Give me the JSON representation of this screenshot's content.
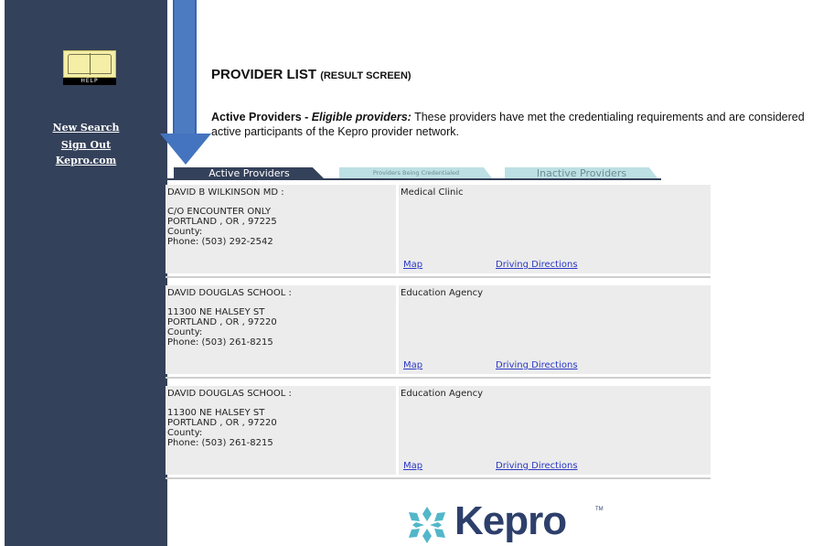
{
  "sidebar": {
    "help_label": "HELP",
    "links": [
      "New Search",
      "Sign Out",
      "Kepro.com"
    ]
  },
  "header": {
    "title": "PROVIDER LIST",
    "title_sub": "(RESULT SCREEN)",
    "desc_bold": "Active Providers - ",
    "desc_italic": "Eligible providers:",
    "desc_rest": " These providers have met the credentialing requirements and are considered active participants of the Kepro provider network."
  },
  "tabs": [
    "Active Providers",
    "Providers Being Credentialed",
    "Inactive Providers"
  ],
  "providers": [
    {
      "name": "DAVID B WILKINSON MD  :",
      "address1": "C/O ENCOUNTER ONLY",
      "address2": "PORTLAND , OR , 97225",
      "county": "County:",
      "phone": "Phone: (503) 292-2542",
      "type": "Medical Clinic",
      "map": "Map",
      "directions": "Driving Directions"
    },
    {
      "name": "DAVID DOUGLAS SCHOOL  :",
      "address1": "11300 NE HALSEY ST",
      "address2": "PORTLAND , OR , 97220",
      "county": "County:",
      "phone": "Phone: (503) 261-8215",
      "type": "Education Agency",
      "map": "Map",
      "directions": "Driving Directions"
    },
    {
      "name": "DAVID DOUGLAS SCHOOL  :",
      "address1": "11300 NE HALSEY ST",
      "address2": "PORTLAND , OR , 97220",
      "county": "County:",
      "phone": "Phone: (503) 261-8215",
      "type": "Education Agency",
      "map": "Map",
      "directions": "Driving Directions"
    }
  ],
  "logo": {
    "text": "Kepro",
    "tm": "TM"
  },
  "colors": {
    "sidebar": "#34415a",
    "tab_inactive": "#bde0e4",
    "link": "#2b38c4",
    "arrow": "#4474bf",
    "logo_mark": "#52b7c9"
  },
  "icons": {
    "help": "book-icon",
    "arrow": "down-arrow-icon",
    "logo": "kepro-star-icon"
  }
}
